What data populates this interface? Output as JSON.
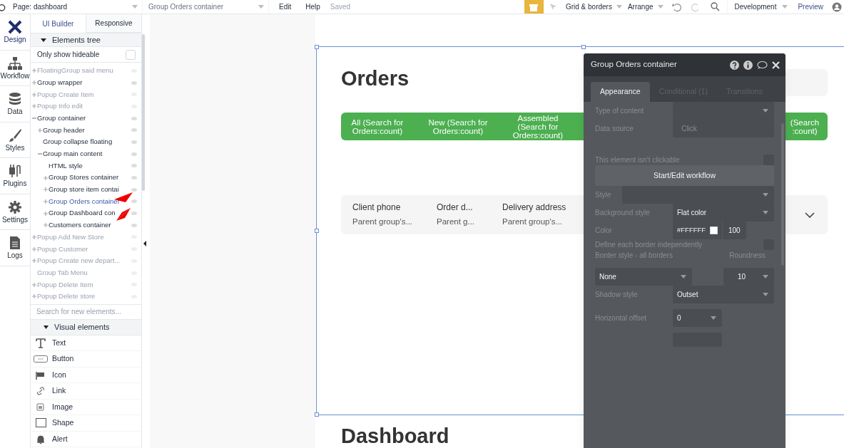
{
  "top_bar": {
    "page_selector": "Page: dashboard",
    "element_selector": "Group Orders container",
    "menu": [
      "Edit",
      "Help"
    ],
    "save_status": "Saved",
    "tools": [
      "Grid & borders",
      "Arrange"
    ],
    "environment": "Development",
    "preview": "Preview"
  },
  "left_nav": [
    {
      "label": "Design",
      "selected": true
    },
    {
      "label": "Workflow",
      "selected": false
    },
    {
      "label": "Data",
      "selected": false
    },
    {
      "label": "Styles",
      "selected": false
    },
    {
      "label": "Plugins",
      "selected": false
    },
    {
      "label": "Settings",
      "selected": false
    },
    {
      "label": "Logs",
      "selected": false
    }
  ],
  "panel_tabs": [
    {
      "label": "UI Builder",
      "selected": true
    },
    {
      "label": "Responsive",
      "selected": false
    }
  ],
  "elements_tree": {
    "title": "Elements tree",
    "filter": {
      "label": "Only show hideable",
      "checked": false
    },
    "items": [
      {
        "label": "FloatingGroup said menu",
        "kind": "collapsed",
        "hidden": true,
        "selected": false
      },
      {
        "label": "Group wrapper",
        "kind": "collapsed",
        "hidden": false,
        "selected": false
      },
      {
        "label": "Popup Create Item",
        "kind": "collapsed",
        "hidden": true,
        "selected": false
      },
      {
        "label": "Popup Info edit",
        "kind": "collapsed",
        "hidden": true,
        "selected": false
      },
      {
        "label": "Group container",
        "kind": "expanded",
        "hidden": false,
        "selected": false,
        "children": [
          {
            "label": "Group header",
            "kind": "collapsed",
            "hidden": false,
            "selected": false
          },
          {
            "label": "Group collapse floating",
            "kind": "leaf",
            "hidden": false,
            "selected": false
          },
          {
            "label": "Group main content",
            "kind": "expanded",
            "hidden": false,
            "selected": false,
            "children": [
              {
                "label": "HTML style",
                "kind": "leaf",
                "hidden": false,
                "selected": false
              },
              {
                "label": "Group Stores container",
                "kind": "collapsed",
                "hidden": false,
                "selected": false
              },
              {
                "label": "Group store item contai",
                "kind": "collapsed",
                "hidden": false,
                "selected": false
              },
              {
                "label": "Group Orders container",
                "kind": "collapsed",
                "hidden": false,
                "selected": true
              },
              {
                "label": "Group Dashboard con",
                "kind": "collapsed",
                "hidden": false,
                "selected": false
              },
              {
                "label": "Customers container",
                "kind": "collapsed",
                "hidden": false,
                "selected": false
              }
            ]
          }
        ]
      },
      {
        "label": "Popup Add New Store",
        "kind": "collapsed",
        "hidden": true,
        "selected": false
      },
      {
        "label": "Popup Customer",
        "kind": "collapsed",
        "hidden": true,
        "selected": false
      },
      {
        "label": "Popup Create new depart...",
        "kind": "collapsed",
        "hidden": true,
        "selected": false
      },
      {
        "label": "Group Tab Menu",
        "kind": "leaf",
        "hidden": true,
        "selected": false
      },
      {
        "label": "Popup Delete Item",
        "kind": "collapsed",
        "hidden": true,
        "selected": false
      },
      {
        "label": "Popup Delete store",
        "kind": "collapsed",
        "hidden": true,
        "selected": false
      }
    ]
  },
  "search": {
    "placeholder": "Search for new elements..."
  },
  "visual_elements": {
    "title": "Visual elements",
    "items": [
      "Text",
      "Button",
      "Icon",
      "Link",
      "Image",
      "Shape",
      "Alert"
    ]
  },
  "canvas": {
    "heading": "Orders",
    "tabs": [
      {
        "label": "All (Search for Orders:count)"
      },
      {
        "label": "New (Search for Orders:count)"
      },
      {
        "label": "Assembled (Search for Orders:count)"
      },
      {
        "label": "(Search :count)"
      }
    ],
    "row_columns": [
      {
        "title": "Client phone",
        "value": "Parent group's..."
      },
      {
        "title": "Order d...",
        "value": "Parent g..."
      },
      {
        "title": "Delivery address",
        "value": "Parent group's..."
      }
    ],
    "next_heading": "Dashboard"
  },
  "property_editor": {
    "title": "Group Orders container",
    "tabs": [
      {
        "label": "Appearance",
        "selected": true
      },
      {
        "label": "Conditional (1)",
        "selected": false
      },
      {
        "label": "Transitions",
        "selected": false
      }
    ],
    "fields": [
      {
        "kind": "select",
        "label": "Type of content"
      },
      {
        "kind": "input",
        "label": "Data source",
        "placeholder": "Click"
      },
      {
        "kind": "checkbox",
        "label": "This element isn't clickable",
        "checked": false
      },
      {
        "kind": "button",
        "label": "Start/Edit workflow"
      },
      {
        "kind": "wide_select",
        "label": "Style"
      },
      {
        "kind": "select",
        "label": "Background style",
        "value": "Flat color"
      },
      {
        "kind": "color",
        "label": "Color",
        "value": "#FFFFFF",
        "opacity": "100"
      },
      {
        "kind": "checkbox",
        "label": "Define each border independently",
        "checked": false
      },
      {
        "kind": "pair",
        "label": "Border style - all borders",
        "value": "None",
        "label2": "Roundness",
        "value2": "10"
      },
      {
        "kind": "select",
        "label": "Shadow style",
        "value": "Outset"
      },
      {
        "kind": "small_select",
        "label": "Horizontal offset",
        "value": "0"
      }
    ]
  }
}
